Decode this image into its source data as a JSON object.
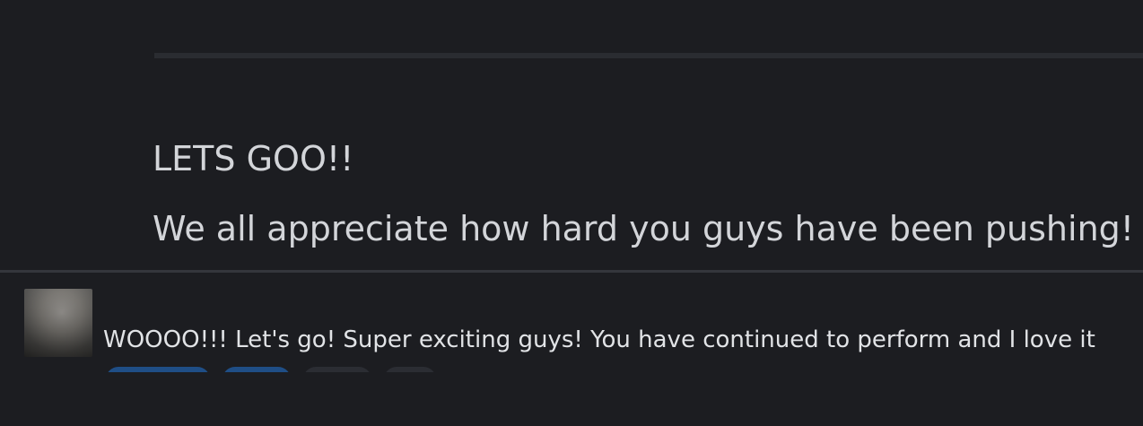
{
  "post": {
    "line1": "LETS GOO!!",
    "line2": "We all appreciate how hard you guys have been pushing!"
  },
  "reply": {
    "text": "WOOOO!!! Let's go! Super exciting guys! You have continued to perform and I love it",
    "avatar_icon": "user-avatar-blurred"
  },
  "reactions": [
    {
      "style": "blue"
    },
    {
      "style": "blue"
    },
    {
      "style": "gray"
    },
    {
      "style": "gray"
    }
  ],
  "colors": {
    "background": "#1c1d21",
    "text_primary": "#d3d5d9",
    "divider": "#34363c",
    "reaction_blue": "#1f4e86",
    "reaction_gray": "#2b2d33"
  }
}
